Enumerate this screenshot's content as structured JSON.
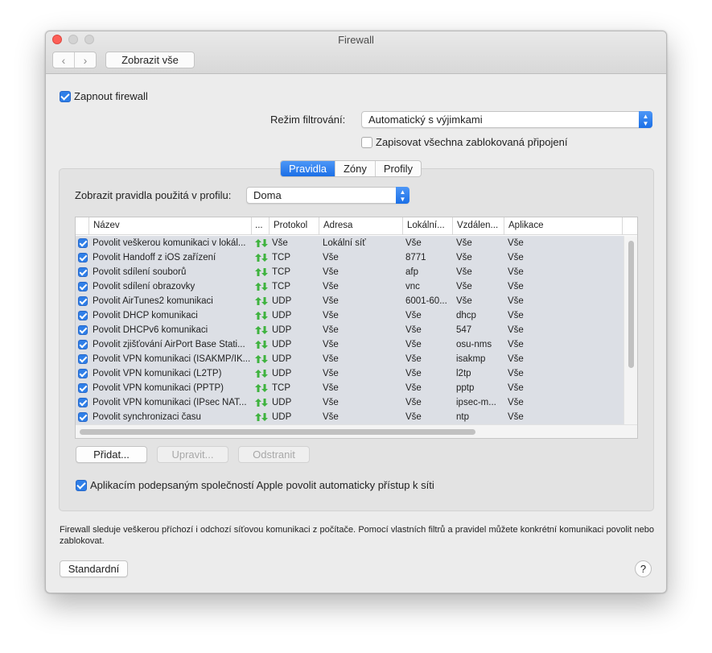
{
  "window": {
    "title": "Firewall",
    "nav_back": "‹",
    "nav_forward": "›",
    "show_all": "Zobrazit vše"
  },
  "settings": {
    "enable_firewall": {
      "label": "Zapnout firewall",
      "checked": true
    },
    "filter_mode": {
      "label": "Režim filtrování:",
      "value": "Automatický s výjimkami"
    },
    "log_blocked": {
      "label": "Zapisovat všechna zablokovaná připojení",
      "checked": false
    }
  },
  "tabs": [
    {
      "label": "Pravidla",
      "active": true
    },
    {
      "label": "Zóny",
      "active": false
    },
    {
      "label": "Profily",
      "active": false
    }
  ],
  "profile": {
    "label": "Zobrazit pravidla použitá v profilu:",
    "value": "Doma"
  },
  "table": {
    "columns": [
      "Název",
      "...",
      "Protokol",
      "Adresa",
      "Lokální...",
      "Vzdálen...",
      "Aplikace"
    ],
    "rows": [
      {
        "name": "Povolit veškerou komunikaci v lokál...",
        "protocol": "Vše",
        "address": "Lokální síť",
        "local": "Vše",
        "remote": "Vše",
        "app": "Vše"
      },
      {
        "name": "Povolit Handoff z iOS zařízení",
        "protocol": "TCP",
        "address": "Vše",
        "local": "8771",
        "remote": "Vše",
        "app": "Vše"
      },
      {
        "name": "Povolit sdílení souborů",
        "protocol": "TCP",
        "address": "Vše",
        "local": "afp",
        "remote": "Vše",
        "app": "Vše"
      },
      {
        "name": "Povolit sdílení obrazovky",
        "protocol": "TCP",
        "address": "Vše",
        "local": "vnc",
        "remote": "Vše",
        "app": "Vše"
      },
      {
        "name": "Povolit AirTunes2 komunikaci",
        "protocol": "UDP",
        "address": "Vše",
        "local": "6001-60...",
        "remote": "Vše",
        "app": "Vše"
      },
      {
        "name": "Povolit DHCP komunikaci",
        "protocol": "UDP",
        "address": "Vše",
        "local": "Vše",
        "remote": "dhcp",
        "app": "Vše"
      },
      {
        "name": "Povolit DHCPv6 komunikaci",
        "protocol": "UDP",
        "address": "Vše",
        "local": "Vše",
        "remote": "547",
        "app": "Vše"
      },
      {
        "name": "Povolit zjišťování AirPort Base Stati...",
        "protocol": "UDP",
        "address": "Vše",
        "local": "Vše",
        "remote": "osu-nms",
        "app": "Vše"
      },
      {
        "name": "Povolit VPN komunikaci (ISAKMP/IK...",
        "protocol": "UDP",
        "address": "Vše",
        "local": "Vše",
        "remote": "isakmp",
        "app": "Vše"
      },
      {
        "name": "Povolit VPN komunikaci (L2TP)",
        "protocol": "UDP",
        "address": "Vše",
        "local": "Vše",
        "remote": "l2tp",
        "app": "Vše"
      },
      {
        "name": "Povolit VPN komunikaci (PPTP)",
        "protocol": "TCP",
        "address": "Vše",
        "local": "Vše",
        "remote": "pptp",
        "app": "Vše"
      },
      {
        "name": "Povolit VPN komunikaci (IPsec NAT...",
        "protocol": "UDP",
        "address": "Vše",
        "local": "Vše",
        "remote": "ipsec-m...",
        "app": "Vše"
      },
      {
        "name": "Povolit synchronizaci času",
        "protocol": "UDP",
        "address": "Vše",
        "local": "Vše",
        "remote": "ntp",
        "app": "Vše"
      }
    ]
  },
  "buttons": {
    "add": "Přidat...",
    "edit": "Upravit...",
    "remove": "Odstranit"
  },
  "apple_signed": {
    "label": "Aplikacím podepsaným společností Apple povolit automaticky přístup k síti",
    "checked": true
  },
  "description": "Firewall sleduje veškerou příchozí i odchozí síťovou komunikaci z počítače. Pomocí vlastních filtrů a pravidel můžete konkrétní komunikaci povolit nebo zablokovat.",
  "footer": {
    "defaults": "Standardní",
    "help": "?"
  },
  "colors": {
    "accent": "#1b6fe6",
    "arrow_green": "#3fb33f"
  }
}
